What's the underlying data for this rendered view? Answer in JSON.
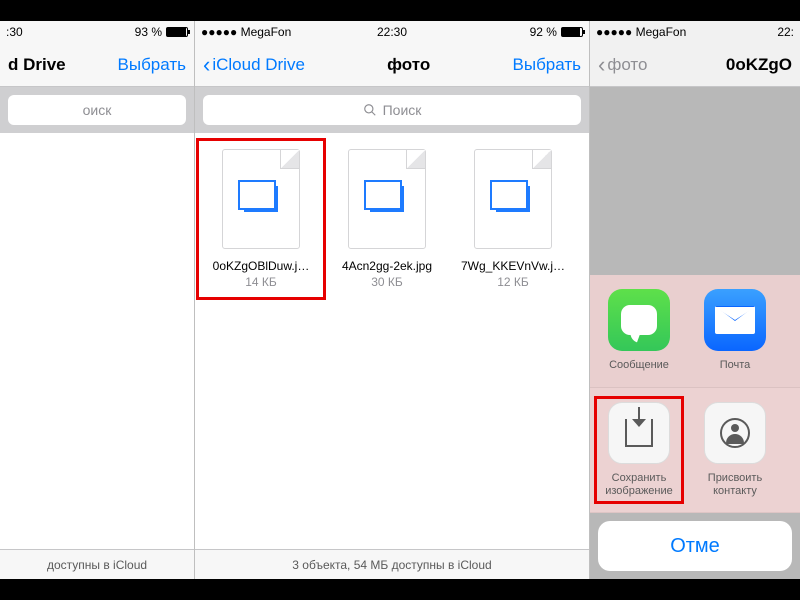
{
  "pane1": {
    "status": {
      "carrier": "",
      "battery_text": "93 %",
      "time": ":30",
      "battery_fill": "93%"
    },
    "nav": {
      "title": "d Drive",
      "action": "Выбрать"
    },
    "search": {
      "placeholder": "оиск"
    },
    "footer": "доступны в iCloud"
  },
  "pane2": {
    "status": {
      "carrier": "●●●●● MegaFon",
      "wifi": "ᯤ",
      "time": "22:30",
      "battery_text": "92 %",
      "battery_fill": "92%"
    },
    "nav": {
      "back": "iCloud Drive",
      "title": "фото",
      "action": "Выбрать"
    },
    "search": {
      "icon": "search",
      "placeholder": "Поиск"
    },
    "files": [
      {
        "name": "0oKZgOBlDuw.j…",
        "size": "14 КБ",
        "highlight": true
      },
      {
        "name": "4Acn2gg-2ek.jpg",
        "size": "30 КБ",
        "highlight": false
      },
      {
        "name": "7Wg_KKEVnVw.j…",
        "size": "12 КБ",
        "highlight": false
      }
    ],
    "footer": "3 объекта, 54 МБ доступны в iCloud"
  },
  "pane3": {
    "status": {
      "carrier": "●●●●● MegaFon",
      "wifi": "ᯤ",
      "time": "22:"
    },
    "nav": {
      "back": "фото",
      "title": "0oKZgO"
    },
    "share_apps": [
      {
        "id": "messages",
        "label": "Сообщение"
      },
      {
        "id": "mail",
        "label": "Почта"
      }
    ],
    "share_actions": [
      {
        "id": "save-image",
        "label": "Сохранить изображение",
        "highlight": true
      },
      {
        "id": "assign-contact",
        "label": "Присвоить контакту",
        "highlight": false
      }
    ],
    "cancel": "Отме"
  }
}
